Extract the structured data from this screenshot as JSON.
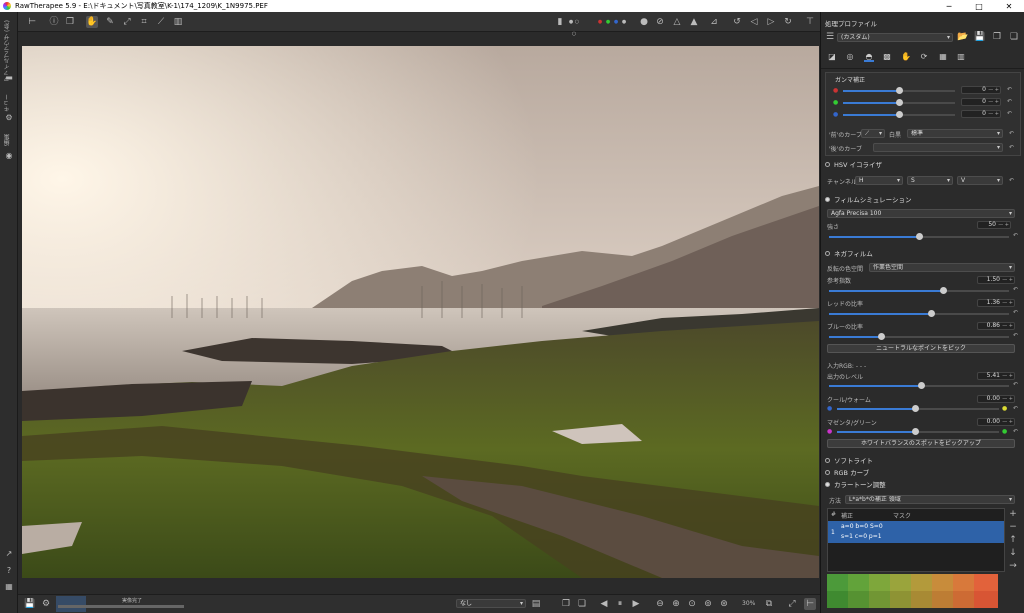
{
  "window": {
    "title": "RawTherapee 5.9 - E:\\ドキュメント\\写真教室\\K-1\\174_1209\\K_1N9975.PEF",
    "minimize": "─",
    "maximize": "□",
    "close": "✕"
  },
  "left_sidebar": {
    "file_browser": "ファイルブラウザ (4k)",
    "queue": "キュー",
    "editor": "編集"
  },
  "status": {
    "processing": "実像完了",
    "profile_none": "なし",
    "zoom": "30%"
  },
  "panel": {
    "header": "処理プロファイル",
    "profile": "(カスタム)",
    "gamma": {
      "title": "ガンマ補正",
      "r": "0",
      "g": "0",
      "b": "0",
      "after_curve": "'前'のカーブ",
      "white": "白黒",
      "std": "標準",
      "before_curve": "'後'のカーブ"
    },
    "hsv": {
      "title": "HSV イコライザ",
      "channel": "チャンネル",
      "h": "H",
      "s": "S",
      "v": "V"
    },
    "film": {
      "title": "フィルムシミュレーション",
      "preset": "Agfa Precisa 100",
      "strength_label": "強さ",
      "strength": "50"
    },
    "negative": {
      "title": "ネガフィルム",
      "colorspace_label": "反転の色空間",
      "colorspace": "作業色空間",
      "ref_exp_label": "参考指数",
      "ref_exp": "1.50",
      "red_label": "レッドの比率",
      "red": "1.36",
      "blue_label": "ブルーの比率",
      "blue": "0.86",
      "neutral_btn": "ニュートラルなポイントをピック",
      "input_rgb": "入力RGB: - - -",
      "out_level_label": "出力のレベル",
      "out_level": "5.41",
      "coolwarm_label": "クール/ウォーム",
      "coolwarm": "0.00",
      "magentagreen_label": "マゼンタ/グリーン",
      "magentagreen": "0.00",
      "wb_btn": "ホワイトバランスのスポットをピックアップ"
    },
    "softlight": "ソフトライト",
    "rgb_curves": "RGB カーブ",
    "colortone": {
      "title": "カラートーン調整",
      "method_label": "方法",
      "method": "L*a*b*の補正 領域",
      "col_hash": "#",
      "col_correction": "補正",
      "col_mask": "マスク",
      "row_num": "1",
      "row_line1": "a=0 b=0 S=0",
      "row_line2": "s=1 c=0 p=1"
    }
  },
  "colors": {
    "accent": "#3a7bd5",
    "selected": "#2e62a8"
  }
}
